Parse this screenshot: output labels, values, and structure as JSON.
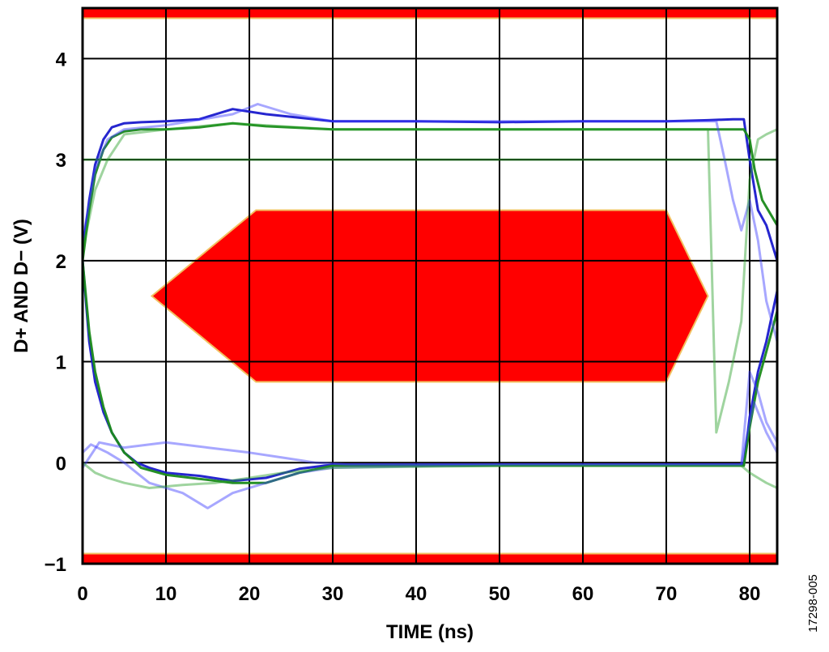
{
  "chart_data": {
    "type": "line",
    "title": "",
    "xlabel": "TIME (ns)",
    "ylabel": "D+ AND D− (V)",
    "xlim": [
      0,
      83.3
    ],
    "ylim": [
      -1,
      4.5
    ],
    "xticks": [
      0,
      10,
      20,
      30,
      40,
      50,
      60,
      70,
      80
    ],
    "yticks": [
      -1,
      0,
      1,
      2,
      3,
      4
    ],
    "ytick_labels": [
      "−1",
      "0",
      "1",
      "2",
      "3",
      "4"
    ],
    "grid": true,
    "figure_id": "17298-005",
    "eye_mask": {
      "polygon": [
        [
          8.3,
          1.65
        ],
        [
          20.8,
          2.5
        ],
        [
          70.0,
          2.5
        ],
        [
          75.0,
          1.65
        ],
        [
          70.0,
          0.8
        ],
        [
          20.8,
          0.8
        ]
      ],
      "top_limit_band": [
        4.4,
        4.5
      ],
      "bottom_limit_band": [
        -1,
        -0.9
      ],
      "color": "#ff0000",
      "edge_color": "#f2c060"
    },
    "series": [
      {
        "color": "#1a1acc",
        "opacity": 0.95,
        "x": [
          0,
          0.8,
          1.5,
          2.5,
          3.5,
          5,
          7,
          10,
          14,
          18,
          22,
          30,
          40,
          50,
          60,
          70,
          75,
          78,
          79.3,
          80,
          81,
          82,
          83.3
        ],
        "y": [
          2.1,
          2.6,
          2.95,
          3.2,
          3.32,
          3.36,
          3.37,
          3.38,
          3.4,
          3.5,
          3.45,
          3.38,
          3.38,
          3.37,
          3.38,
          3.38,
          3.39,
          3.4,
          3.4,
          3.0,
          2.5,
          2.35,
          2.0
        ]
      },
      {
        "color": "#1a1acc",
        "opacity": 0.95,
        "x": [
          0,
          0.8,
          1.5,
          2.5,
          3.5,
          5,
          6.5,
          8,
          10,
          14,
          18,
          22,
          26,
          30,
          40,
          50,
          60,
          70,
          75,
          79.3,
          80,
          81,
          82,
          83.3
        ],
        "y": [
          2.0,
          1.2,
          0.8,
          0.5,
          0.3,
          0.1,
          0.0,
          -0.05,
          -0.1,
          -0.13,
          -0.18,
          -0.15,
          -0.06,
          -0.02,
          -0.02,
          -0.02,
          -0.02,
          -0.02,
          -0.02,
          -0.02,
          0.45,
          0.9,
          1.2,
          1.7
        ]
      },
      {
        "color": "#1a8a1a",
        "opacity": 0.95,
        "x": [
          0,
          0.8,
          1.5,
          2.5,
          3.5,
          5,
          7,
          10,
          14,
          18,
          22,
          30,
          40,
          50,
          60,
          70,
          75,
          79.3,
          80,
          80.6,
          81.5,
          83.3
        ],
        "y": [
          2.0,
          2.5,
          2.85,
          3.1,
          3.22,
          3.28,
          3.3,
          3.3,
          3.32,
          3.36,
          3.33,
          3.3,
          3.3,
          3.3,
          3.3,
          3.3,
          3.3,
          3.3,
          3.2,
          2.9,
          2.6,
          2.35
        ]
      },
      {
        "color": "#1a8a1a",
        "opacity": 0.95,
        "x": [
          0,
          0.8,
          1.5,
          2.5,
          3.5,
          5,
          7,
          10,
          14,
          18,
          22,
          26,
          30,
          40,
          50,
          60,
          70,
          75,
          79.3,
          80,
          81,
          82,
          83.3
        ],
        "y": [
          2.0,
          1.3,
          0.9,
          0.55,
          0.3,
          0.1,
          -0.05,
          -0.12,
          -0.16,
          -0.2,
          -0.2,
          -0.1,
          -0.03,
          -0.03,
          -0.03,
          -0.03,
          -0.03,
          -0.03,
          -0.03,
          0.35,
          0.8,
          1.1,
          1.5
        ]
      },
      {
        "color": "#3c3cff",
        "opacity": 0.45,
        "x": [
          0,
          1.5,
          3,
          5,
          10,
          18,
          21,
          25,
          30,
          50,
          70,
          76,
          77,
          78,
          79,
          80,
          81,
          82,
          83.3
        ],
        "y": [
          2.2,
          2.9,
          3.2,
          3.3,
          3.34,
          3.45,
          3.55,
          3.45,
          3.38,
          3.38,
          3.38,
          3.38,
          3.0,
          2.6,
          2.3,
          2.6,
          2.2,
          1.6,
          1.2
        ]
      },
      {
        "color": "#3c3cff",
        "opacity": 0.45,
        "x": [
          0,
          1,
          3,
          5,
          8,
          12,
          15,
          18,
          22,
          26,
          30,
          50,
          70,
          79,
          80,
          81,
          82,
          83.3
        ],
        "y": [
          0.1,
          0.18,
          0.1,
          0.0,
          -0.2,
          -0.3,
          -0.45,
          -0.3,
          -0.2,
          -0.1,
          -0.05,
          -0.02,
          -0.02,
          -0.02,
          0.9,
          0.7,
          0.4,
          0.2
        ]
      },
      {
        "color": "#3c3cff",
        "opacity": 0.45,
        "x": [
          0,
          2,
          5,
          10,
          15,
          20,
          24,
          28,
          32,
          40,
          60,
          79,
          80.5,
          82,
          83.3
        ],
        "y": [
          -0.05,
          0.2,
          0.15,
          0.2,
          0.15,
          0.1,
          0.05,
          0.0,
          -0.02,
          -0.02,
          -0.02,
          -0.02,
          0.6,
          0.3,
          0.1
        ]
      },
      {
        "color": "#2aa02a",
        "opacity": 0.45,
        "x": [
          0,
          5,
          10,
          20,
          30,
          40,
          50,
          60,
          70,
          80,
          83.3
        ],
        "y": [
          3.0,
          3.0,
          3.0,
          3.0,
          3.0,
          3.0,
          3.0,
          3.0,
          3.0,
          3.0,
          3.0
        ]
      },
      {
        "color": "#2aa02a",
        "opacity": 0.45,
        "x": [
          0,
          1.5,
          3,
          5,
          10,
          18,
          22,
          30,
          50,
          70,
          75,
          76,
          77.5,
          79,
          80,
          81,
          82,
          83.3
        ],
        "y": [
          2.1,
          2.7,
          3.0,
          3.25,
          3.3,
          3.36,
          3.34,
          3.3,
          3.3,
          3.3,
          3.3,
          0.3,
          0.8,
          1.4,
          2.8,
          3.2,
          3.25,
          3.3
        ]
      },
      {
        "color": "#2aa02a",
        "opacity": 0.45,
        "x": [
          0,
          1.5,
          3,
          5,
          8,
          12,
          16,
          20,
          24,
          30,
          50,
          79,
          80,
          81,
          82,
          83.3
        ],
        "y": [
          0.0,
          -0.1,
          -0.15,
          -0.2,
          -0.25,
          -0.22,
          -0.2,
          -0.15,
          -0.1,
          -0.05,
          -0.03,
          -0.03,
          -0.1,
          -0.15,
          -0.2,
          -0.25
        ]
      }
    ]
  }
}
